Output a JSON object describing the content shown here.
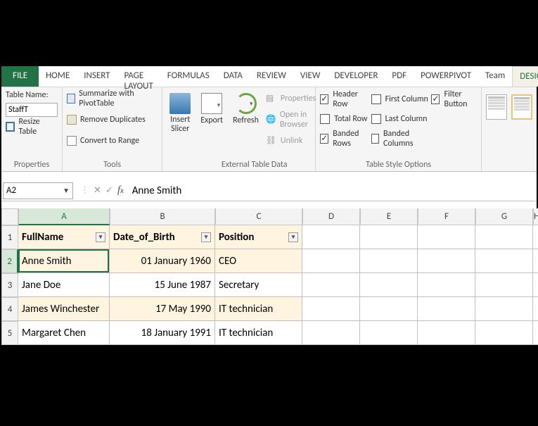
{
  "ribbon": {
    "file": "FILE",
    "tabs": [
      "HOME",
      "INSERT",
      "PAGE LAYOUT",
      "FORMULAS",
      "DATA",
      "REVIEW",
      "VIEW",
      "DEVELOPER",
      "PDF",
      "POWERPIVOT",
      "Team",
      "DESIGN"
    ],
    "active_tab": "DESIGN",
    "groups": {
      "properties": {
        "label": "Properties",
        "table_name_label": "Table Name:",
        "table_name_value": "StaffT",
        "resize_label": "Resize Table"
      },
      "tools": {
        "label": "Tools",
        "summarize": "Summarize with PivotTable",
        "remove_dup": "Remove Duplicates",
        "convert": "Convert to Range",
        "slicer": "Insert Slicer"
      },
      "external": {
        "label": "External Table Data",
        "export": "Export",
        "refresh": "Refresh",
        "properties": "Properties",
        "open_browser": "Open in Browser",
        "unlink": "Unlink"
      },
      "style_options": {
        "label": "Table Style Options",
        "header_row": "Header Row",
        "total_row": "Total Row",
        "banded_rows": "Banded Rows",
        "first_column": "First Column",
        "last_column": "Last Column",
        "banded_columns": "Banded Columns",
        "filter_button": "Filter Button",
        "checks": {
          "header_row": true,
          "total_row": false,
          "banded_rows": true,
          "first_column": false,
          "last_column": false,
          "banded_columns": false,
          "filter_button": true
        }
      }
    }
  },
  "formula_bar": {
    "name_box": "A2",
    "value": "Anne Smith"
  },
  "sheet": {
    "col_headers": [
      "A",
      "B",
      "C",
      "D",
      "E",
      "F",
      "G",
      "H"
    ],
    "active_cell": "A2",
    "header_row": [
      "FullName",
      "Date_of_Birth",
      "Position"
    ],
    "rows": [
      {
        "FullName": "Anne Smith",
        "Date_of_Birth": "01 January 1960",
        "Position": "CEO"
      },
      {
        "FullName": "Jane Doe",
        "Date_of_Birth": "15 June 1987",
        "Position": "Secretary"
      },
      {
        "FullName": "James Winchester",
        "Date_of_Birth": "17 May 1990",
        "Position": "IT technician"
      },
      {
        "FullName": "Margaret Chen",
        "Date_of_Birth": "18 January 1991",
        "Position": "IT technician"
      }
    ]
  }
}
